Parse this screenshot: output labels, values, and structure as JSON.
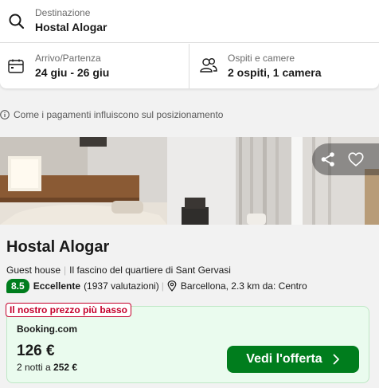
{
  "search": {
    "destination": {
      "label": "Destinazione",
      "value": "Hostal Alogar",
      "icon": "search-icon"
    },
    "dates": {
      "label": "Arrivo/Partenza",
      "value": "24 giu - 26 giu",
      "icon": "calendar-icon"
    },
    "guests": {
      "label": "Ospiti e camere",
      "value": "2 ospiti, 1 camera",
      "icon": "people-icon"
    }
  },
  "info_notice": {
    "text": "Come i pagamenti influiscono sul posizionamento",
    "icon": "info-icon"
  },
  "photo_actions": {
    "share_icon": "share-icon",
    "favorite_icon": "heart-icon"
  },
  "hotel": {
    "name": "Hostal Alogar",
    "type": "Guest house",
    "tagline": "Il fascino del quartiere di Sant Gervasi",
    "rating_score": "8.5",
    "rating_word": "Eccellente",
    "rating_count": "(1937 valutazioni)",
    "location": "Barcellona, 2.3 km da: Centro"
  },
  "offer": {
    "tag": "Il nostro prezzo più basso",
    "provider": "Booking.com",
    "price": "126 €",
    "nights_label": "2 notti a",
    "total_price": "252 €",
    "cta_label": "Vedi l'offerta"
  },
  "colors": {
    "accent_green": "#007d1d",
    "deal_red": "#c4002b",
    "offer_bg": "#eafbee"
  }
}
